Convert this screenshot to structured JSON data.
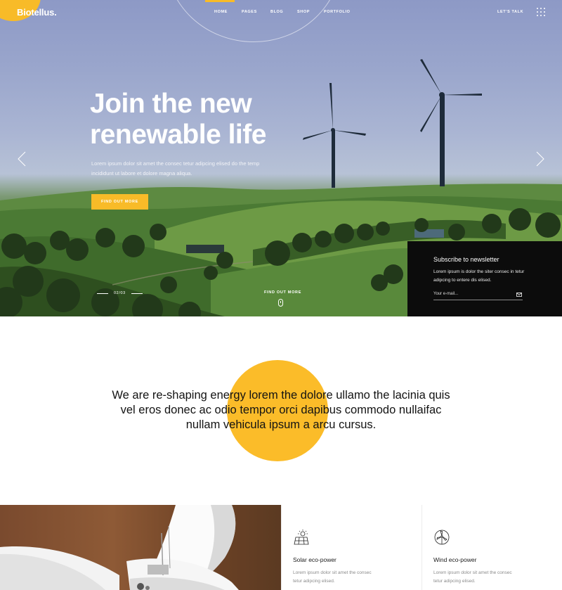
{
  "header": {
    "logo": "Biotellus.",
    "nav": [
      "HOME",
      "PAGES",
      "BLOG",
      "SHOP",
      "PORTFOLIO"
    ],
    "lets_talk": "LET'S TALK",
    "menu_icon": "grid-dots-icon"
  },
  "hero": {
    "title_line1": "Join the new",
    "title_line2": "renewable life",
    "description": "Lorem ipsum dolor sit amet the consec tetur adipcing elised do the temp incididunt ut labore et dolore magna aliqua.",
    "button": "FIND OUT MORE",
    "slide_current": "02",
    "slide_total": "03",
    "scroll_label": "FIND OUT MORE"
  },
  "newsletter": {
    "title": "Subscribe to newsletter",
    "text": "Lorem ipsum is dolor the siter consec in tetur adipcing to entere dis elised.",
    "placeholder": "Your e-mail..."
  },
  "intro": {
    "text": "We are re-shaping energy lorem the dolore ullamo the lacinia quis vel eros donec ac odio tempor orci dapibus commodo nullaifac nullam vehicula ipsum a arcu cursus."
  },
  "features": [
    {
      "icon": "solar-panel-icon",
      "title": "Solar eco-power",
      "text": "Lorem ipsum dolor sit amet the consec tetur adipcing elised."
    },
    {
      "icon": "wind-turbine-icon",
      "title": "Wind eco-power",
      "text": "Lorem ipsum dolor sit amet the consec tetur adipcing elised."
    }
  ],
  "colors": {
    "accent": "#f8bb28",
    "dark": "#0c0c0c"
  }
}
